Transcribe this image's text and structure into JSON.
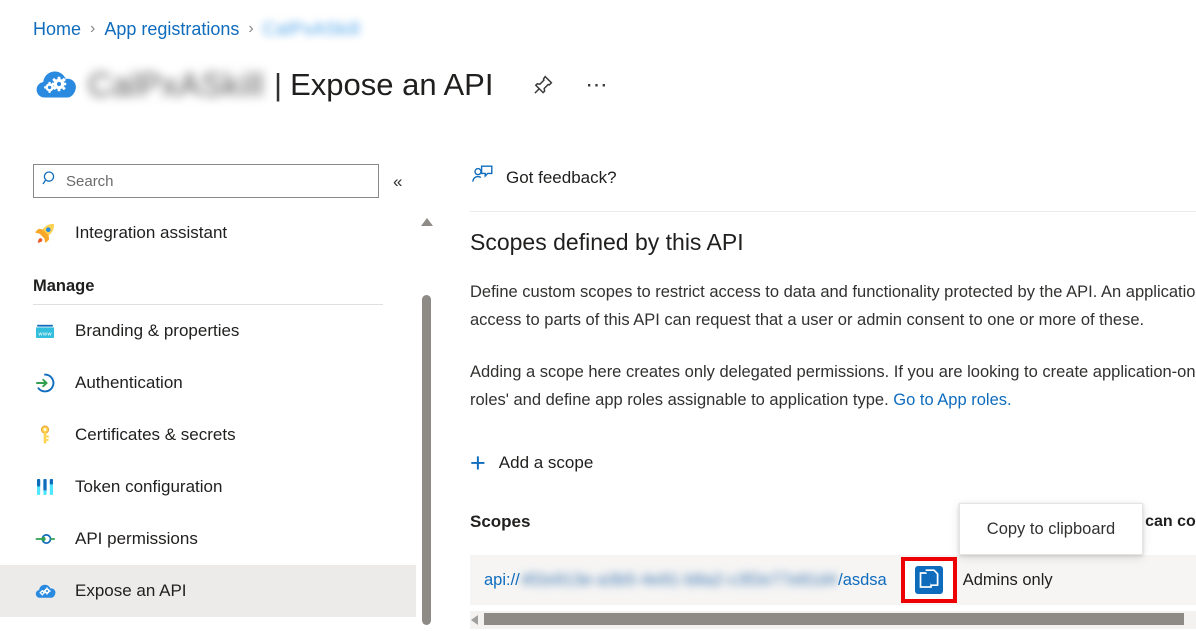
{
  "breadcrumb": {
    "home": "Home",
    "app_registrations": "App registrations",
    "separator": "›",
    "current_redacted": "CalPxASkill"
  },
  "header": {
    "app_name_redacted": "CalPxASkill",
    "pipe": "|",
    "page_title": "Expose an API",
    "pin_icon": "pin-icon",
    "more_icon": "ellipsis-icon",
    "app_icon": "cloud-gears-icon"
  },
  "sidebar": {
    "search": {
      "placeholder": "Search",
      "value": "",
      "icon": "search-icon"
    },
    "collapse_label": "«",
    "items": [
      {
        "label": "Integration assistant",
        "icon": "rocket-icon",
        "selected": false
      }
    ],
    "group_label": "Manage",
    "manage_items": [
      {
        "label": "Branding & properties",
        "icon": "browser-window-icon",
        "selected": false
      },
      {
        "label": "Authentication",
        "icon": "arrow-in-circle-icon",
        "selected": false
      },
      {
        "label": "Certificates & secrets",
        "icon": "key-icon",
        "selected": false
      },
      {
        "label": "Token configuration",
        "icon": "sliders-icon",
        "selected": false
      },
      {
        "label": "API permissions",
        "icon": "plug-connector-icon",
        "selected": false
      },
      {
        "label": "Expose an API",
        "icon": "cloud-gears-icon",
        "selected": true
      }
    ]
  },
  "main": {
    "feedback_label": "Got feedback?",
    "feedback_icon": "person-feedback-icon",
    "heading": "Scopes defined by this API",
    "paragraph1": "Define custom scopes to restrict access to data and functionality protected by the API. An application that requires access to parts of this API can request that a user or admin consent to one or more of these.",
    "paragraph2_before_link": "Adding a scope here creates only delegated permissions. If you are looking to create application-only scopes, use 'App roles' and define app roles assignable to application type. ",
    "paragraph2_link": "Go to App roles.",
    "add_scope_label": "Add a scope",
    "add_scope_icon": "plus-icon",
    "scopes_label": "Scopes",
    "consent_column_header": "Who can consent",
    "scope_row": {
      "prefix": "api://",
      "guid_redacted": "4f2e913e-a3b5-4e91-b8a2-c3f2e77e81d4",
      "suffix": "/asdsa",
      "copy_icon": "copy-to-clipboard-icon",
      "consent_value": "Admins only"
    },
    "tooltip": {
      "text": "Copy to clipboard"
    }
  },
  "colors": {
    "accent_blue": "#0f6cbd",
    "icon_blue": "#0078d4",
    "highlight_red": "#ee0000",
    "row_bg": "#f6f5f4",
    "selected_nav_bg": "#edebe9",
    "scrollbar": "#8e8b87"
  },
  "scrollbars": {
    "vertical_nav": "nav-vertical-scrollbar",
    "horizontal_table": "table-horizontal-scrollbar"
  }
}
